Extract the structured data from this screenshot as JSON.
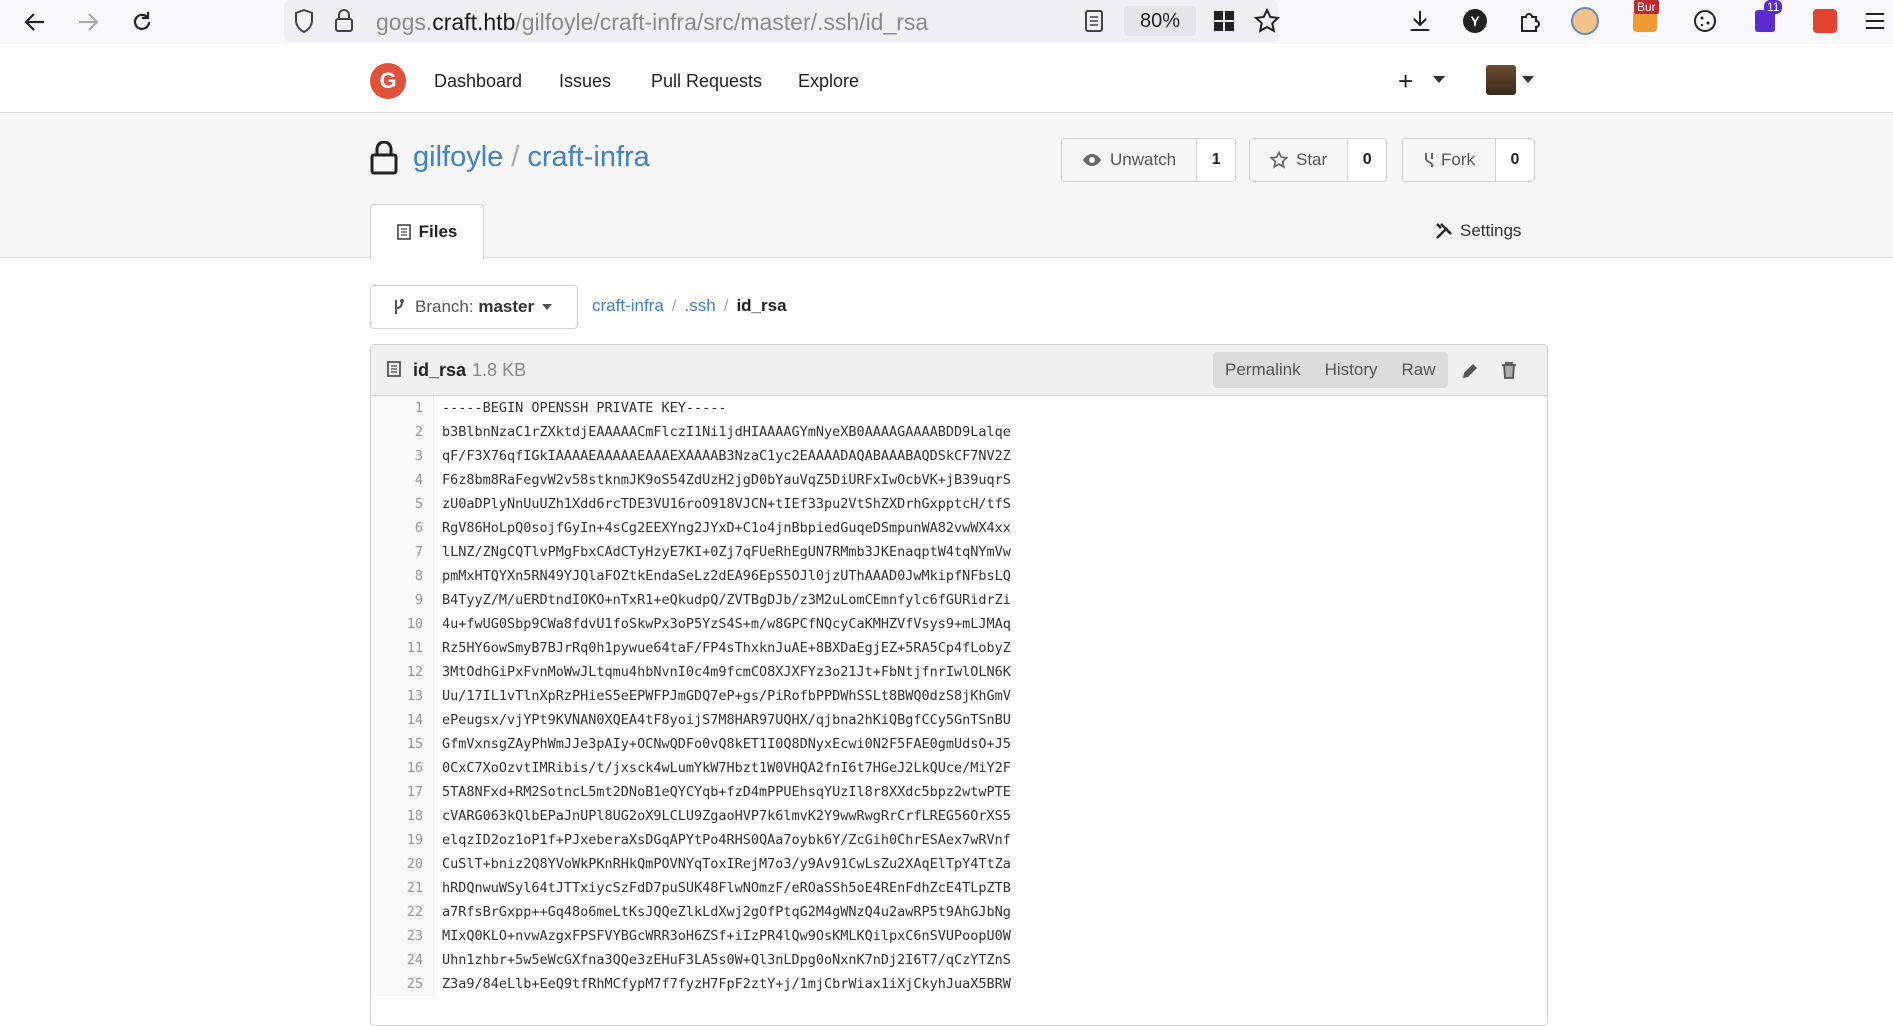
{
  "browser": {
    "url_prefix": "gogs.",
    "url_domain": "craft.htb",
    "url_path": "/gilfoyle/craft-infra/src/master/.ssh/id_rsa",
    "zoom": "80%",
    "badge_bur": "Bur",
    "badge_count": "11"
  },
  "header": {
    "nav": [
      "Dashboard",
      "Issues",
      "Pull Requests",
      "Explore"
    ],
    "plus": "+"
  },
  "repo": {
    "owner": "gilfoyle",
    "sep": "/",
    "name": "craft-infra",
    "unwatch_label": "Unwatch",
    "watch_count": "1",
    "star_label": "Star",
    "star_count": "0",
    "fork_label": "Fork",
    "fork_count": "0",
    "tab_files": "Files",
    "settings": "Settings"
  },
  "branch": {
    "label": "Branch:",
    "value": "master"
  },
  "breadcrumb": {
    "root": "craft-infra",
    "dir": ".ssh",
    "file": "id_rsa",
    "sep": "/"
  },
  "file": {
    "name": "id_rsa",
    "size": "1.8 KB",
    "permalink": "Permalink",
    "history": "History",
    "raw": "Raw",
    "lines": [
      {
        "n": "1",
        "t": "-----BEGIN OPENSSH PRIVATE KEY-----"
      },
      {
        "n": "2",
        "t": "b3BlbnNzaC1rZXktdjEAAAAACmFlczI1Ni1jdHIAAAAGYmNyeXB0AAAAGAAAABDD9Lalqe"
      },
      {
        "n": "3",
        "t": "qF/F3X76qfIGkIAAAAEAAAAAEAAAEXAAAAB3NzaC1yc2EAAAADAQABAAABAQDSkCF7NV2Z"
      },
      {
        "n": "4",
        "t": "F6z8bm8RaFegvW2v58stknmJK9oS54ZdUzH2jgD0bYauVqZ5DiURFxIwOcbVK+jB39uqrS"
      },
      {
        "n": "5",
        "t": "zU0aDPlyNnUuUZh1Xdd6rcTDE3VU16roO918VJCN+tIEf33pu2VtShZXDrhGxpptcH/tfS"
      },
      {
        "n": "6",
        "t": "RgV86HoLpQ0sojfGyIn+4sCg2EEXYng2JYxD+C1o4jnBbpiedGuqeDSmpunWA82vwWX4xx"
      },
      {
        "n": "7",
        "t": "lLNZ/ZNgCQTlvPMgFbxCAdCTyHzyE7KI+0Zj7qFUeRhEgUN7RMmb3JKEnaqptW4tqNYmVw"
      },
      {
        "n": "8",
        "t": "pmMxHTQYXn5RN49YJQlaFOZtkEndaSeLz2dEA96EpS5OJl0jzUThAAAD0JwMkipfNFbsLQ"
      },
      {
        "n": "9",
        "t": "B4TyyZ/M/uERDtndIOKO+nTxR1+eQkudpQ/ZVTBgDJb/z3M2uLomCEmnfylc6fGURidrZi"
      },
      {
        "n": "10",
        "t": "4u+fwUG0Sbp9CWa8fdvU1foSkwPx3oP5YzS4S+m/w8GPCfNQcyCaKMHZVfVsys9+mLJMAq"
      },
      {
        "n": "11",
        "t": "Rz5HY6owSmyB7BJrRq0h1pywue64taF/FP4sThxknJuAE+8BXDaEgjEZ+5RA5Cp4fLobyZ"
      },
      {
        "n": "12",
        "t": "3MtOdhGiPxFvnMoWwJLtqmu4hbNvnI0c4m9fcmCO8XJXFYz3o21Jt+FbNtjfnrIwlOLN6K"
      },
      {
        "n": "13",
        "t": "Uu/17IL1vTlnXpRzPHieS5eEPWFPJmGDQ7eP+gs/PiRofbPPDWhSSLt8BWQ0dzS8jKhGmV"
      },
      {
        "n": "14",
        "t": "ePeugsx/vjYPt9KVNAN0XQEA4tF8yoijS7M8HAR97UQHX/qjbna2hKiQBgfCCy5GnTSnBU"
      },
      {
        "n": "15",
        "t": "GfmVxnsgZAyPhWmJJe3pAIy+OCNwQDFo0vQ8kET1I0Q8DNyxEcwi0N2F5FAE0gmUdsO+J5"
      },
      {
        "n": "16",
        "t": "0CxC7XoOzvtIMRibis/t/jxsck4wLumYkW7Hbzt1W0VHQA2fnI6t7HGeJ2LkQUce/MiY2F"
      },
      {
        "n": "17",
        "t": "5TA8NFxd+RM2SotncL5mt2DNoB1eQYCYqb+fzD4mPPUEhsqYUzIl8r8XXdc5bpz2wtwPTE"
      },
      {
        "n": "18",
        "t": "cVARG063kQlbEPaJnUPl8UG2oX9LCLU9ZgaoHVP7k6lmvK2Y9wwRwgRrCrfLREG56OrXS5"
      },
      {
        "n": "19",
        "t": "elqzID2oz1oP1f+PJxeberaXsDGqAPYtPo4RHS0QAa7oybk6Y/ZcGih0ChrESAex7wRVnf"
      },
      {
        "n": "20",
        "t": "CuSlT+bniz2Q8YVoWkPKnRHkQmPOVNYqToxIRejM7o3/y9Av91CwLsZu2XAqElTpY4TtZa"
      },
      {
        "n": "21",
        "t": "hRDQnwuWSyl64tJTTxiycSzFdD7puSUK48FlwNOmzF/eROaSSh5oE4REnFdhZcE4TLpZTB"
      },
      {
        "n": "22",
        "t": "a7RfsBrGxpp++Gq48o6meLtKsJQQeZlkLdXwj2gOfPtqG2M4gWNzQ4u2awRP5t9AhGJbNg"
      },
      {
        "n": "23",
        "t": "MIxQ0KLO+nvwAzgxFPSFVYBGcWRR3oH6ZSf+iIzPR4lQw9OsKMLKQilpxC6nSVUPoopU0W"
      },
      {
        "n": "24",
        "t": "Uhn1zhbr+5w5eWcGXfna3QQe3zEHuF3LA5s0W+Ql3nLDpg0oNxnK7nDj2I6T7/qCzYTZnS"
      },
      {
        "n": "25",
        "t": "Z3a9/84eLlb+EeQ9tfRhMCfypM7f7fyzH7FpF2ztY+j/1mjCbrWiax1iXjCkyhJuaX5BRW"
      }
    ]
  },
  "colors": {
    "link": "#4183c4",
    "logo": "#e0523a"
  }
}
